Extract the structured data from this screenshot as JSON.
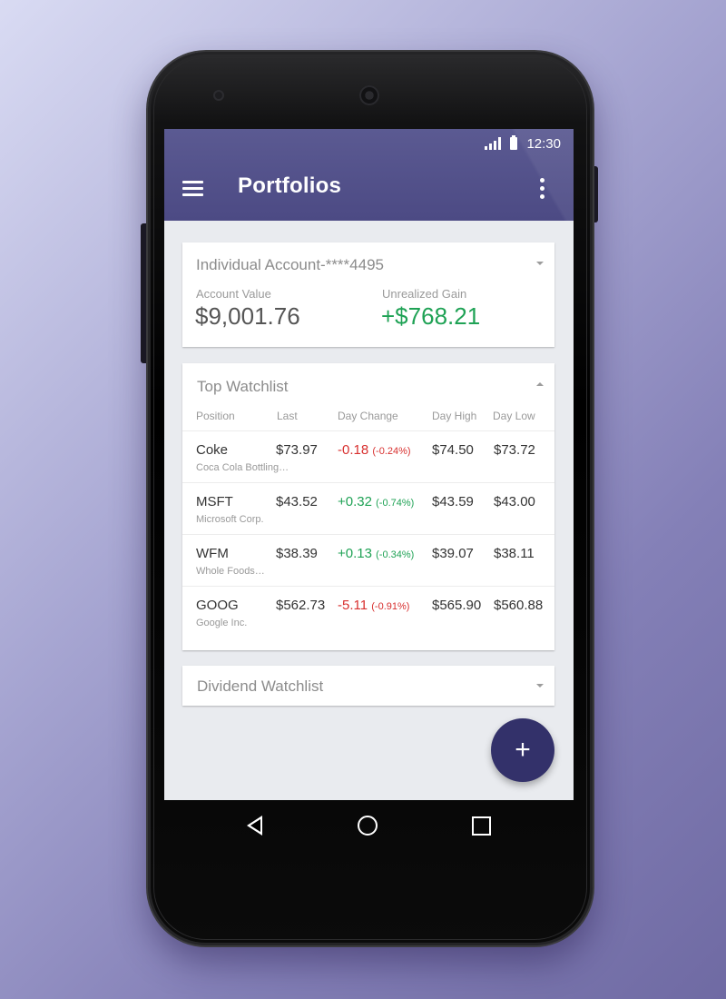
{
  "status_bar": {
    "time": "12:30",
    "signal_icon": "signal-icon",
    "battery_icon": "battery-icon"
  },
  "app_bar": {
    "title": "Portfolios",
    "menu_icon": "hamburger-menu-icon",
    "overflow_icon": "more-vert-icon"
  },
  "account_card": {
    "name": "Individual Account-****4495",
    "account_value_label": "Account Value",
    "account_value": "$9,001.76",
    "unrealized_gain_label": "Unrealized Gain",
    "unrealized_gain": "+$768.21"
  },
  "top_watchlist": {
    "title": "Top Watchlist",
    "columns": [
      "Position",
      "Last",
      "Day Change",
      "Day High",
      "Day Low"
    ],
    "rows": [
      {
        "symbol": "Coke",
        "company": "Coca Cola Bottling…",
        "last": "$73.97",
        "change": "-0.18",
        "change_pct": "(-0.24%)",
        "direction": "down",
        "high": "$74.50",
        "low": "$73.72"
      },
      {
        "symbol": "MSFT",
        "company": "Microsoft Corp.",
        "last": "$43.52",
        "change": "+0.32",
        "change_pct": "(-0.74%)",
        "direction": "up",
        "high": "$43.59",
        "low": "$43.00"
      },
      {
        "symbol": "WFM",
        "company": "Whole Foods…",
        "last": "$38.39",
        "change": "+0.13",
        "change_pct": "(-0.34%)",
        "direction": "up",
        "high": "$39.07",
        "low": "$38.11"
      },
      {
        "symbol": "GOOG",
        "company": "Google Inc.",
        "last": "$562.73",
        "change": "-5.11",
        "change_pct": "(-0.91%)",
        "direction": "down",
        "high": "$565.90",
        "low": "$560.88"
      }
    ]
  },
  "dividend_watchlist": {
    "title": "Dividend Watchlist"
  },
  "fab": {
    "label": "+",
    "icon": "plus-icon"
  },
  "nav_bar": {
    "back_icon": "back-triangle-icon",
    "home_icon": "home-circle-icon",
    "recents_icon": "recents-square-icon"
  },
  "colors": {
    "app_bar": "#4c4a84",
    "fab": "#33316a",
    "positive": "#1fa255",
    "negative": "#d8302f"
  }
}
